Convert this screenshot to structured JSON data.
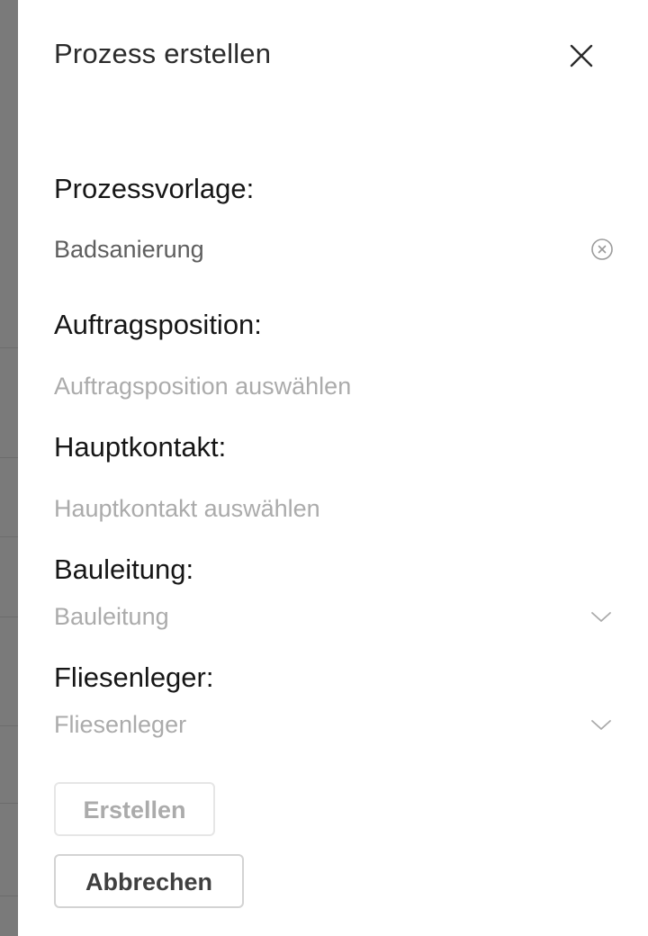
{
  "dialog": {
    "title": "Prozess erstellen",
    "close_icon": "close-icon"
  },
  "fields": {
    "prozessvorlage": {
      "label": "Prozessvorlage:",
      "value": "Badsanierung",
      "clear_icon": "clear-circle-icon"
    },
    "auftragsposition": {
      "label": "Auftragsposition:",
      "placeholder": "Auftragsposition auswählen"
    },
    "hauptkontakt": {
      "label": "Hauptkontakt:",
      "placeholder": "Hauptkontakt auswählen"
    },
    "bauleitung": {
      "label": "Bauleitung:",
      "placeholder": "Bauleitung",
      "icon": "chevron-down-icon"
    },
    "fliesenleger": {
      "label": "Fliesenleger:",
      "placeholder": "Fliesenleger",
      "icon": "chevron-down-icon"
    }
  },
  "actions": {
    "create_label": "Erstellen",
    "cancel_label": "Abbrechen"
  },
  "colors": {
    "label": "#161616",
    "value": "#5e5e5e",
    "placeholder": "#ababab",
    "disabled_border": "#e6e6e6",
    "overlay": "#7a7a7a"
  }
}
